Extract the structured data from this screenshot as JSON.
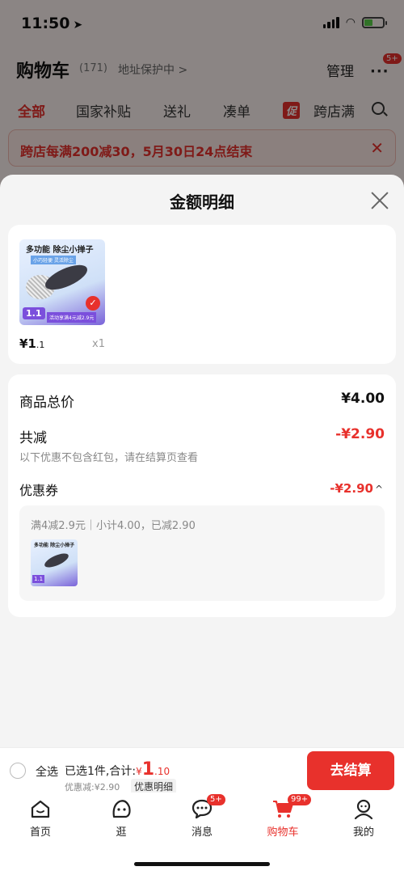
{
  "status_bar": {
    "time": "11:50"
  },
  "header": {
    "title": "购物车",
    "count": "(171)",
    "address": "地址保护中 >",
    "manage": "管理",
    "more_badge": "5+"
  },
  "category_tabs": [
    "全部",
    "国家补贴",
    "送礼",
    "凑单"
  ],
  "promo_tag": "促",
  "promo_tab_label": "跨店满",
  "promo_banner": "跨店每满200减30，5月30日24点结束",
  "sheet": {
    "title": "金额明细",
    "product": {
      "img_title": "多功能 除尘小掸子",
      "img_sub": "小巧轻便 灵活除尘",
      "img_price": "1.1",
      "img_activity": "活动享满4元减2.9元",
      "price_main": "¥1",
      "price_dec": ".1",
      "qty": "x1"
    },
    "total_label": "商品总价",
    "total_value": "¥4.00",
    "reduce_label": "共减",
    "reduce_value": "-¥2.90",
    "note": "以下优惠不包含红包，请在结算页查看",
    "coupon_label": "优惠券",
    "coupon_value": "-¥2.90",
    "coupon_desc": "满4减2.9元｜小计4.00，已减2.90",
    "thumb_title": "多功能 除尘小掸子",
    "thumb_price": "1.1"
  },
  "checkout": {
    "select_all": "全选",
    "selected_text": "已选1件,合计:",
    "total_yen": "¥",
    "total_big": "1",
    "total_dec": ".10",
    "discount": "优惠减:¥2.90",
    "detail_link": "优惠明细",
    "button": "去结算"
  },
  "tabbar": {
    "items": [
      {
        "label": "首页",
        "icon": "home-icon"
      },
      {
        "label": "逛",
        "icon": "browse-icon"
      },
      {
        "label": "消息",
        "icon": "message-icon",
        "badge": "5+"
      },
      {
        "label": "购物车",
        "icon": "cart-icon",
        "badge": "99+"
      },
      {
        "label": "我的",
        "icon": "profile-icon"
      }
    ]
  },
  "colors": {
    "accent": "#e8312c"
  }
}
